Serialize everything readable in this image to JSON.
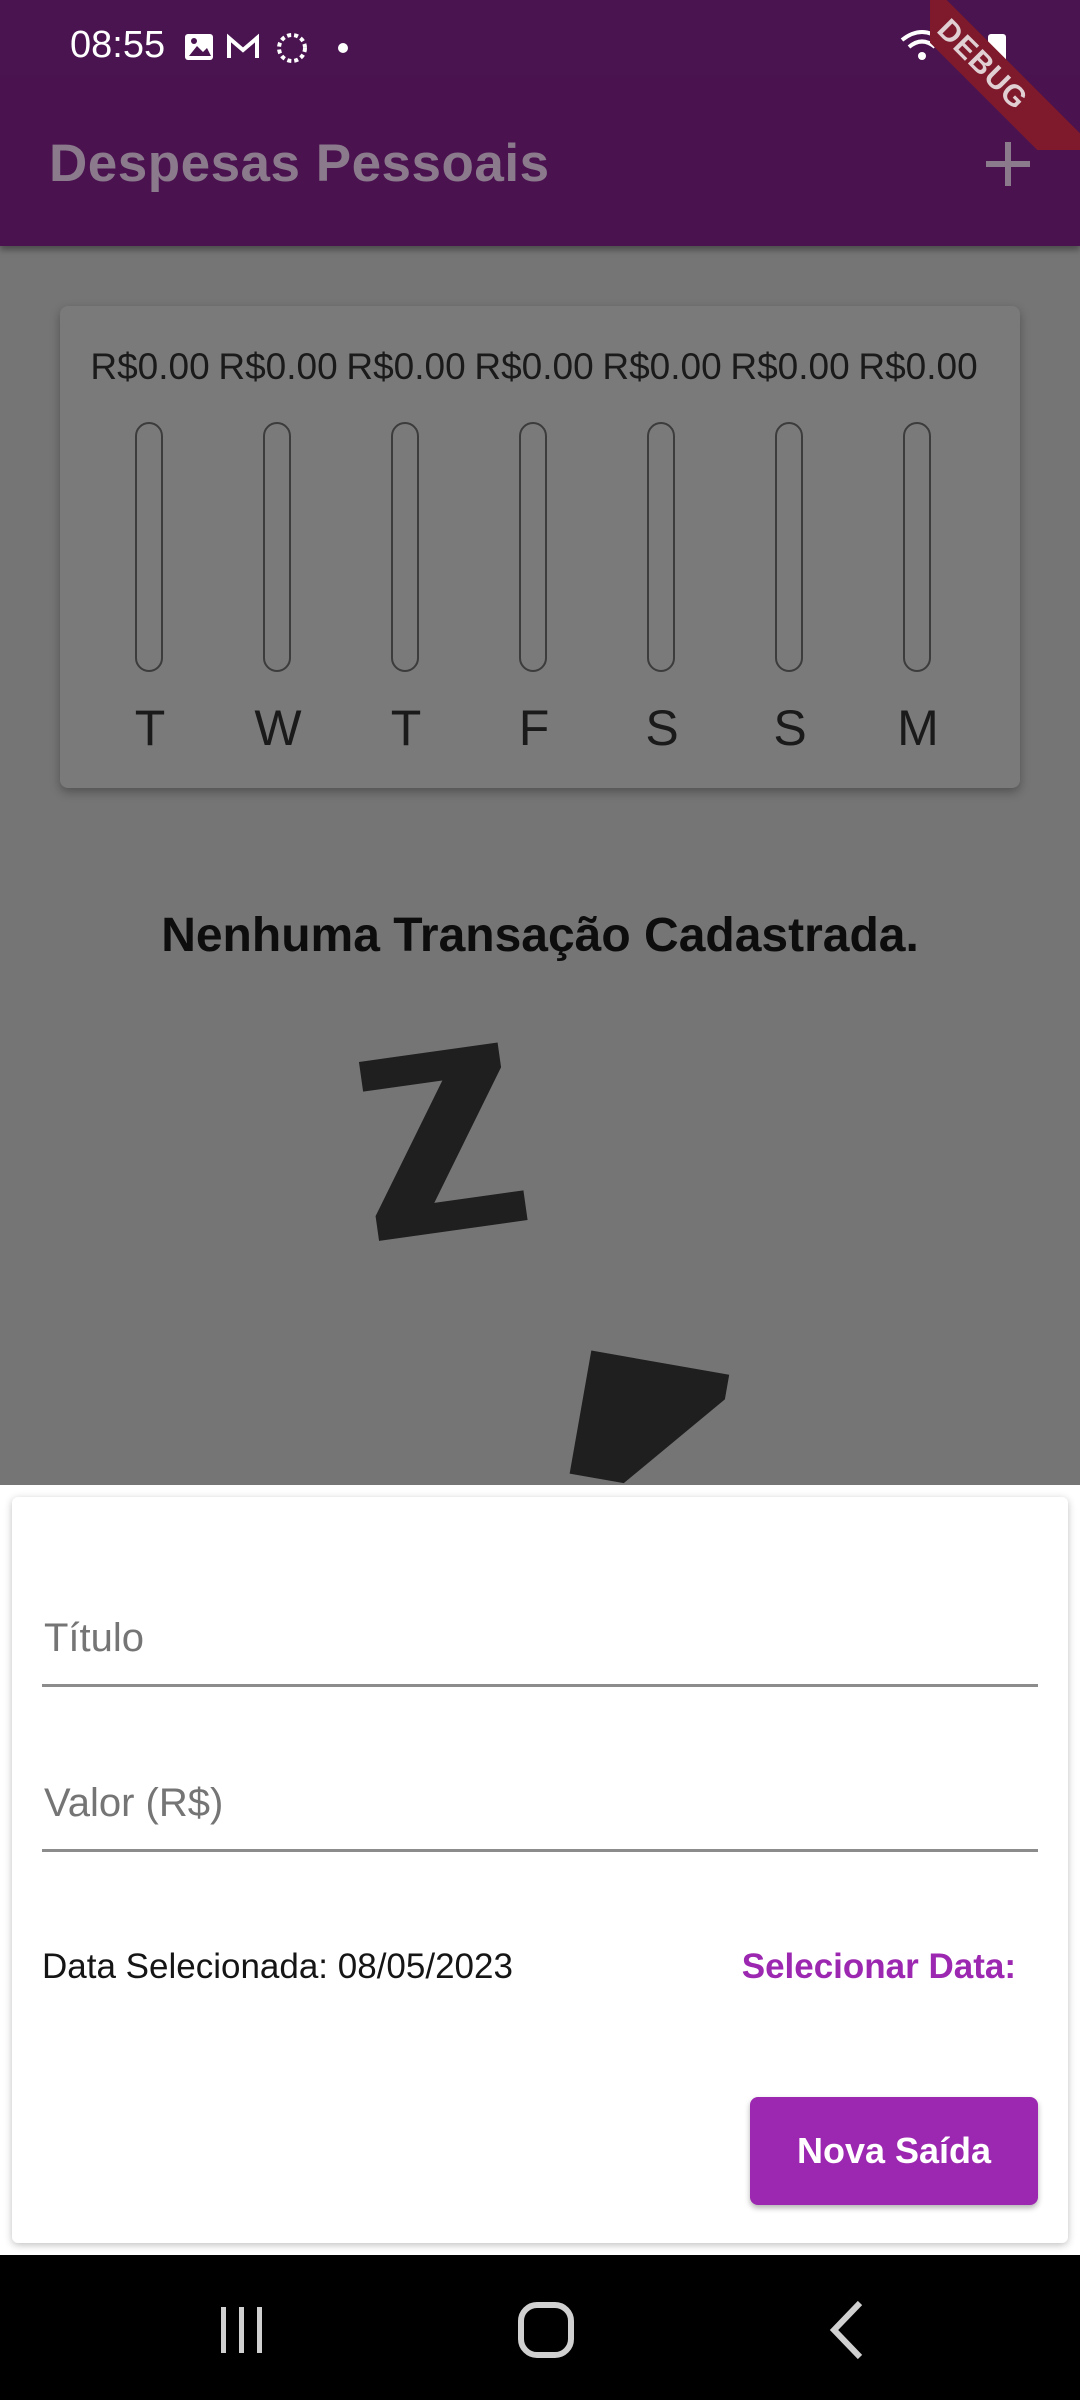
{
  "status_bar": {
    "time": "08:55",
    "left_icons": [
      "image-icon",
      "gmail-icon",
      "sync-icon",
      "dot-icon"
    ],
    "right_icons": [
      "wifi-icon",
      "signal-icon",
      "battery-icon"
    ]
  },
  "app_bar": {
    "title": "Despesas Pessoais",
    "add_icon": "plus-icon",
    "debug_banner": "DEBUG"
  },
  "chart_data": {
    "type": "bar",
    "categories": [
      "T",
      "W",
      "T",
      "F",
      "S",
      "S",
      "M"
    ],
    "value_labels": [
      "R$0.00",
      "R$0.00",
      "R$0.00",
      "R$0.00",
      "R$0.00",
      "R$0.00",
      "R$0.00"
    ],
    "values": [
      0,
      0,
      0,
      0,
      0,
      0,
      0
    ],
    "fill_fractions": [
      0,
      0,
      0,
      0,
      0,
      0,
      0
    ]
  },
  "empty_state": {
    "message": "Nenhuma Transação Cadastrada.",
    "image": "zzz-sleep-icon"
  },
  "form": {
    "title_field": {
      "placeholder": "Título",
      "value": ""
    },
    "value_field": {
      "placeholder": "Valor (R$)",
      "value": ""
    },
    "date_label": "Data Selecionada: 08/05/2023",
    "select_date_label": "Selecionar Data:",
    "submit_label": "Nova Saída"
  },
  "nav_bar": {
    "items": [
      "recent-apps-icon",
      "home-icon",
      "back-icon"
    ]
  },
  "colors": {
    "primary": "#9c27b0",
    "app_bar": "#4b1250",
    "scrim": "#757575"
  }
}
